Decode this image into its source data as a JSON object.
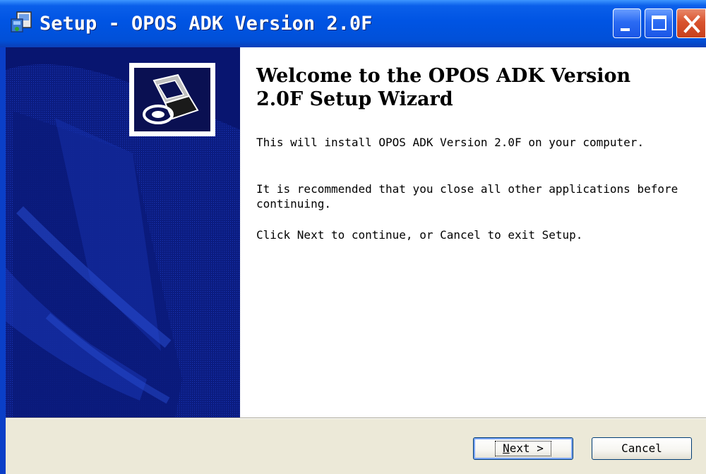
{
  "window": {
    "title": "Setup - OPOS ADK Version 2.0F"
  },
  "titlebar": {
    "icons": [
      "setup-app-icon",
      "minimize-icon",
      "maximize-icon",
      "close-icon"
    ]
  },
  "wizard": {
    "heading": "Welcome to the OPOS ADK Version 2.0F Setup Wizard",
    "paragraph1": "This will install OPOS ADK Version 2.0F on your computer.",
    "paragraph2": "It is recommended that you close all other applications before continuing.",
    "paragraph3": "Click Next to continue, or Cancel to exit Setup."
  },
  "buttons": {
    "next_mnemonic": "N",
    "next_rest": "ext >",
    "cancel_label": "Cancel"
  },
  "colors": {
    "titlebar_blue": "#0054E3",
    "side_panel": "#0A1A7A",
    "close_red": "#D9532E",
    "dialog_bg": "#ECE9D8"
  }
}
